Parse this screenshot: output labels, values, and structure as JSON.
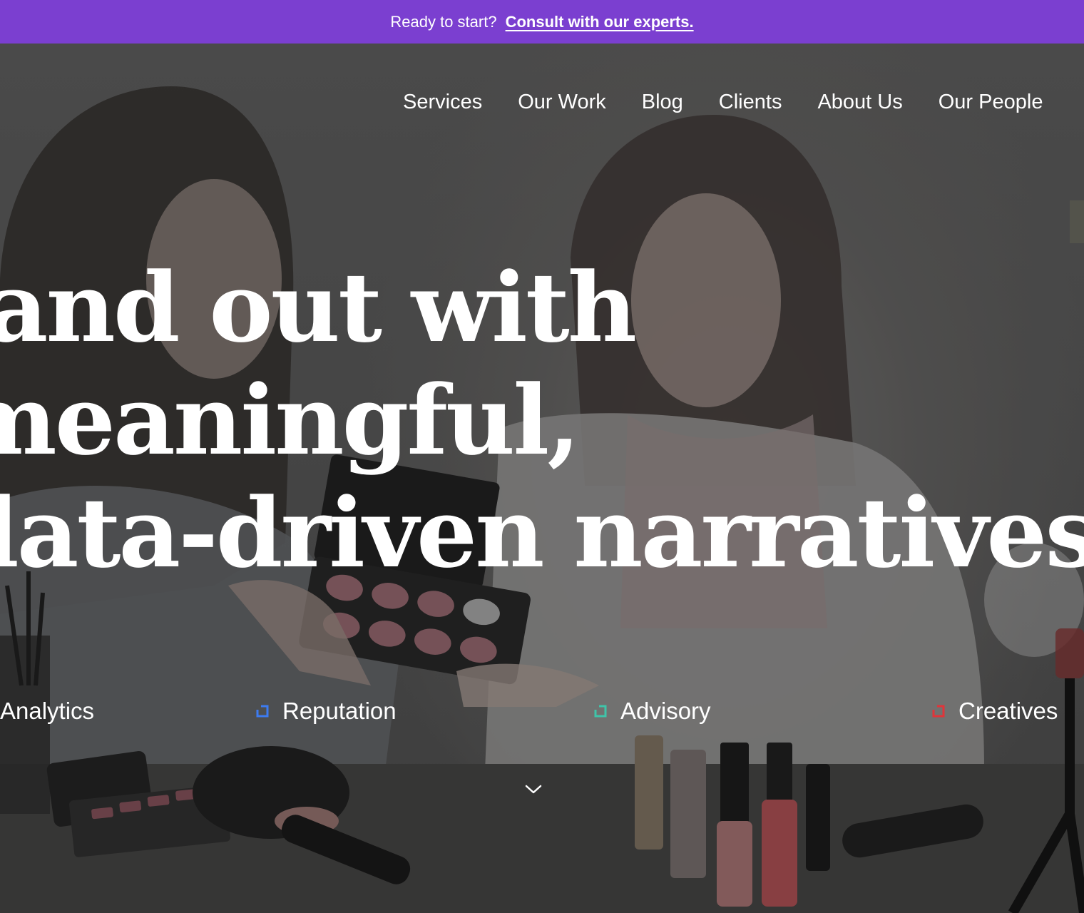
{
  "announcement": {
    "text": "Ready to start?",
    "link": "Consult with our experts.",
    "background": "#7b3fd0"
  },
  "nav": {
    "items": [
      {
        "label": "Services"
      },
      {
        "label": "Our Work"
      },
      {
        "label": "Blog"
      },
      {
        "label": "Clients"
      },
      {
        "label": "About Us"
      },
      {
        "label": "Our People"
      }
    ]
  },
  "hero": {
    "headline": [
      "Stand out with",
      "meaningful,",
      "data-driven narratives."
    ]
  },
  "services": [
    {
      "label": "Analytics",
      "color": "#f2b705",
      "icon": "bracket-square-icon"
    },
    {
      "label": "Reputation",
      "color": "#3d7bf0",
      "icon": "bracket-square-icon"
    },
    {
      "label": "Advisory",
      "color": "#3fc4a9",
      "icon": "bracket-square-icon"
    },
    {
      "label": "Creatives",
      "color": "#e0353a",
      "icon": "bracket-square-icon"
    }
  ],
  "scroll": {
    "icon": "chevron-down-icon"
  }
}
